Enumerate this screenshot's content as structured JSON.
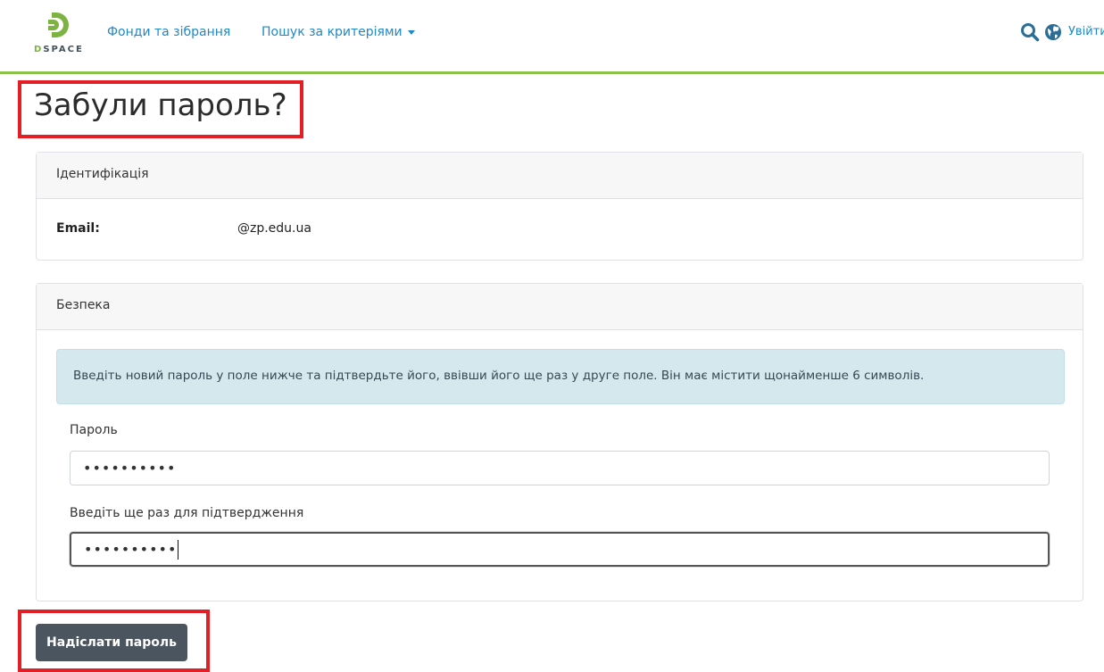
{
  "header": {
    "logo_text": "DSPACE",
    "nav": [
      {
        "label": "Фонди та зібрання"
      },
      {
        "label": "Пошук за критеріями"
      }
    ],
    "login_label": "Увійти"
  },
  "page": {
    "title": "Забули пароль?"
  },
  "identification": {
    "header": "Ідентифікація",
    "email_label": "Email:",
    "email_value": "@zp.edu.ua"
  },
  "security": {
    "header": "Безпека",
    "info": "Введіть новий пароль у поле нижче та підтвердьте його, ввівши його ще раз у друге поле. Він має містити щонайменше 6 символів.",
    "password_label": "Пароль",
    "password_value": "••••••••••",
    "confirm_label": "Введіть ще раз для підтвердження",
    "confirm_value": "••••••••••"
  },
  "submit_label": "Надіслати пароль",
  "colors": {
    "accent_line": "#8bc34a",
    "link": "#1e88c8",
    "highlight": "#e31e24",
    "button": "#4a5560"
  }
}
